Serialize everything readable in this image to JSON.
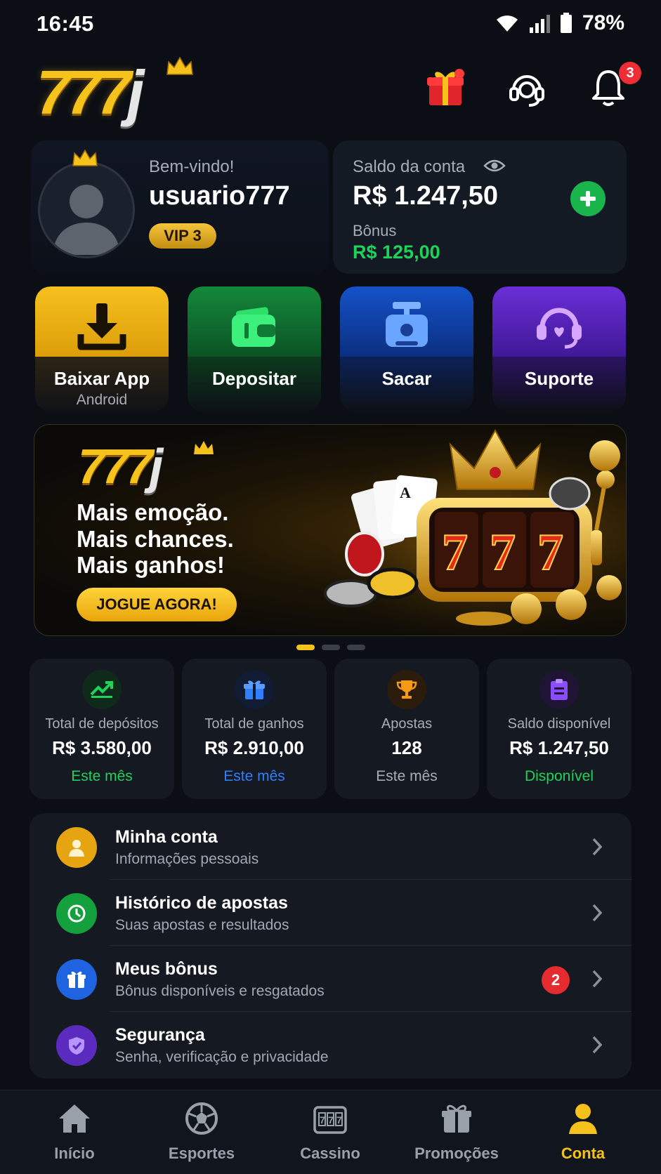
{
  "status_bar": {
    "time": "16:45",
    "battery": "78%"
  },
  "header": {
    "logo_text": "777",
    "logo_letter": "j",
    "notifications_count": "3"
  },
  "profile": {
    "welcome": "Bem-vindo!",
    "username": "usuario777",
    "vip": "VIP 3"
  },
  "balance": {
    "label": "Saldo da conta",
    "value": "R$ 1.247,50",
    "bonus_label": "Bônus",
    "bonus_value": "R$ 125,00"
  },
  "actions": [
    {
      "label": "Baixar App",
      "sub": "Android",
      "icon": "download-icon"
    },
    {
      "label": "Depositar",
      "icon": "wallet-icon"
    },
    {
      "label": "Sacar",
      "icon": "cash-register-icon"
    },
    {
      "label": "Suporte",
      "icon": "headset-icon"
    }
  ],
  "banner": {
    "logo_text": "777",
    "logo_letter": "j",
    "line1": "Mais emoção.",
    "line2": "Mais chances.",
    "line3": "Mais ganhos!",
    "cta": "JOGUE AGORA!",
    "slides_total": 3,
    "active_slide": 1
  },
  "stats": [
    {
      "label": "Total de depósitos",
      "value": "R$ 3.580,00",
      "sub": "Este mês",
      "sub_color": "#1fd25a",
      "icon": "trend-up-icon"
    },
    {
      "label": "Total de ganhos",
      "value": "R$ 2.910,00",
      "sub": "Este mês",
      "sub_color": "#2f7fff",
      "icon": "gift-icon"
    },
    {
      "label": "Apostas",
      "value": "128",
      "sub": "Este mês",
      "sub_color": "#a9adb5",
      "icon": "trophy-icon"
    },
    {
      "label": "Saldo disponível",
      "value": "R$ 1.247,50",
      "sub": "Disponível",
      "sub_color": "#1fd25a",
      "icon": "clipboard-icon"
    }
  ],
  "menu": [
    {
      "title": "Minha conta",
      "sub": "Informações pessoais",
      "icon": "user-icon",
      "color": "#e6a410"
    },
    {
      "title": "Histórico de apostas",
      "sub": "Suas apostas e resultados",
      "icon": "clock-icon",
      "color": "#13a03d"
    },
    {
      "title": "Meus bônus",
      "sub": "Bônus disponíveis e resgatados",
      "icon": "gift-icon",
      "color": "#1f63e0",
      "badge": "2"
    },
    {
      "title": "Segurança",
      "sub": "Senha, verificação e privacidade",
      "icon": "shield-icon",
      "color": "#5b2bbf"
    }
  ],
  "nav": [
    {
      "label": "Início",
      "icon": "home-icon"
    },
    {
      "label": "Esportes",
      "icon": "soccer-ball-icon"
    },
    {
      "label": "Cassino",
      "icon": "slot-machine-icon"
    },
    {
      "label": "Promoções",
      "icon": "gift-icon"
    },
    {
      "label": "Conta",
      "icon": "user-icon",
      "active": true
    }
  ],
  "colors": {
    "accent": "#f5c21b",
    "positive": "#1fd25a",
    "background": "#0b0e14"
  }
}
